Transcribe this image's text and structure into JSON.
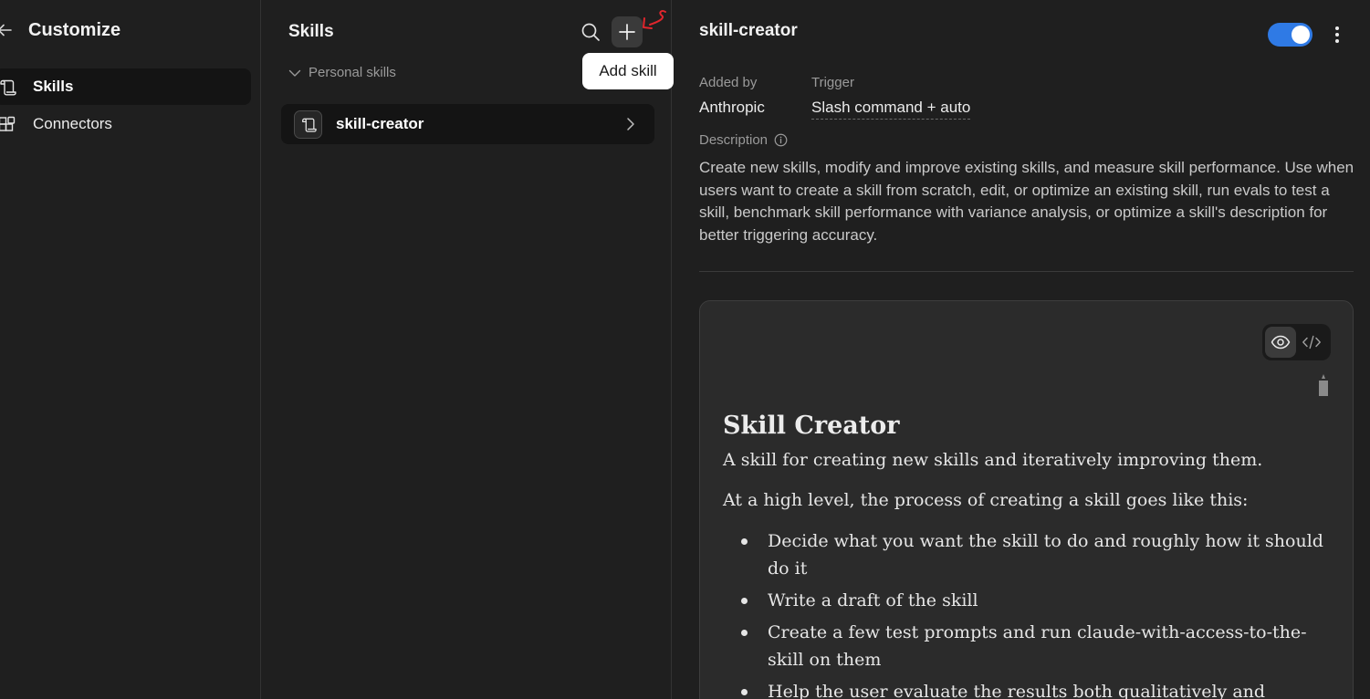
{
  "nav": {
    "title": "Customize",
    "items": [
      {
        "label": "Skills",
        "icon": "skill-icon",
        "active": true
      },
      {
        "label": "Connectors",
        "icon": "connectors-icon",
        "active": false
      }
    ]
  },
  "list": {
    "title": "Skills",
    "add_tooltip": "Add skill",
    "group_label": "Personal skills",
    "items": [
      {
        "label": "skill-creator",
        "icon": "skill-icon"
      }
    ]
  },
  "detail": {
    "title": "skill-creator",
    "enabled": true,
    "added_by_label": "Added by",
    "added_by_value": "Anthropic",
    "trigger_label": "Trigger",
    "trigger_value": "Slash command + auto",
    "description_label": "Description",
    "description_text": "Create new skills, modify and improve existing skills, and measure skill performance. Use when users want to create a skill from scratch, edit, or optimize an existing skill, run evals to test a skill, benchmark skill performance with variance analysis, or optimize a skill's description for better triggering accuracy.",
    "preview": {
      "heading": "Skill Creator",
      "paragraphs": [
        "A skill for creating new skills and iteratively improving them.",
        "At a high level, the process of creating a skill goes like this:"
      ],
      "bullets": [
        "Decide what you want the skill to do and roughly how it should do it",
        "Write a draft of the skill",
        "Create a few test prompts and run claude-with-access-to-the-skill on them",
        "Help the user evaluate the results both qualitatively and"
      ]
    }
  },
  "colors": {
    "background": "#1f1f1f",
    "toggle_on": "#2f7ae5",
    "annotation_red": "#e0262d"
  }
}
